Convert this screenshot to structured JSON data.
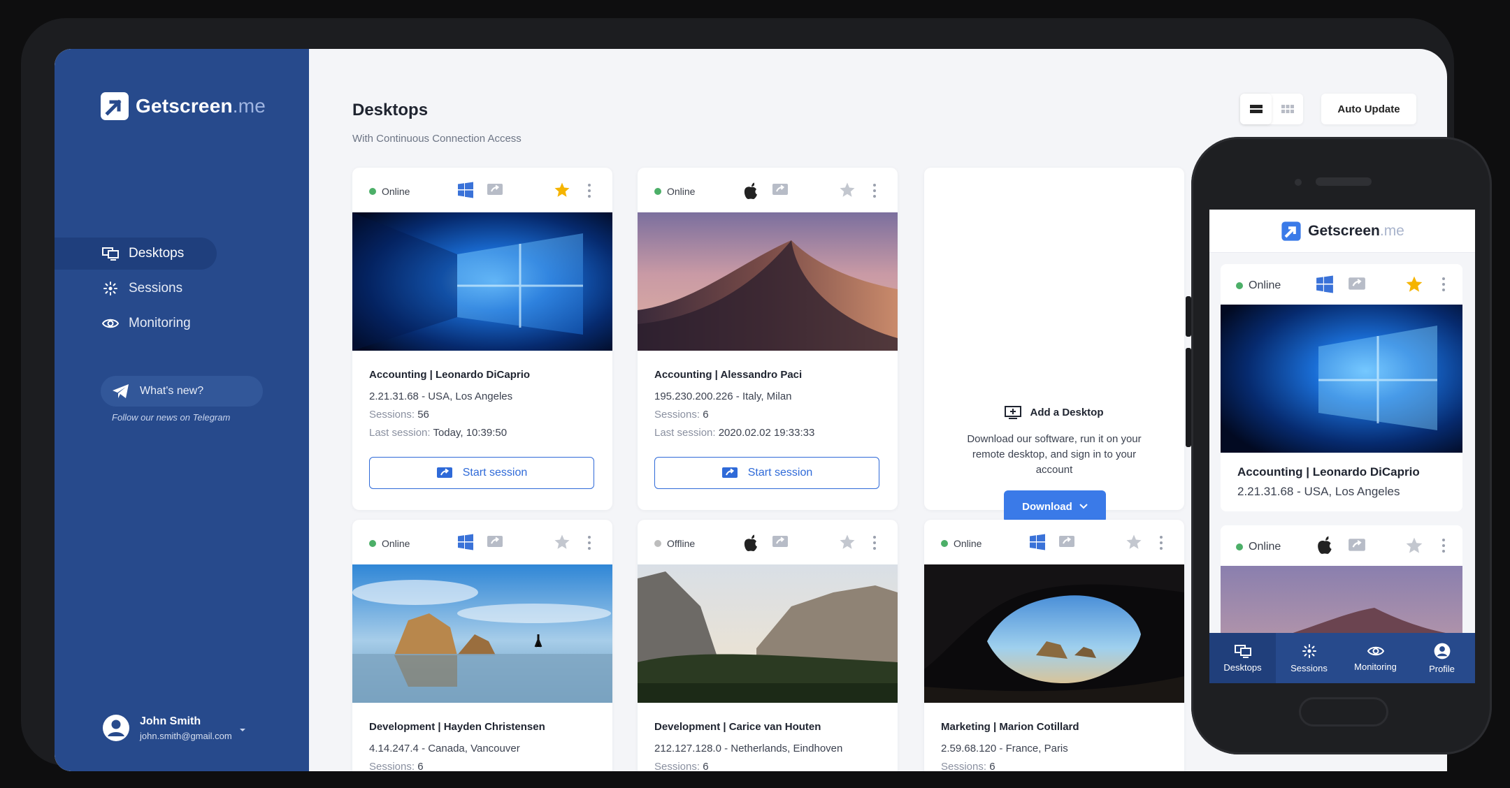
{
  "brand": {
    "name": "Getscreen",
    "suffix": ".me"
  },
  "sidebar": {
    "nav": [
      {
        "label": "Desktops",
        "icon": "desktops-icon",
        "active": true
      },
      {
        "label": "Sessions",
        "icon": "sessions-icon",
        "active": false
      },
      {
        "label": "Monitoring",
        "icon": "monitoring-icon",
        "active": false
      }
    ],
    "whats_new": "What's new?",
    "follow": "Follow our news on Telegram",
    "user": {
      "name": "John Smith",
      "email": "john.smith@gmail.com"
    }
  },
  "header": {
    "title": "Desktops",
    "subtitle": "With Continuous Connection Access",
    "auto_update": "Auto Update"
  },
  "cards": [
    {
      "status": "Online",
      "os": "windows",
      "starred": true,
      "title": "Accounting | Leonardo DiCaprio",
      "address": "2.21.31.68 - USA, Los Angeles",
      "sessions_label": "Sessions:",
      "sessions": "56",
      "last_label": "Last session:",
      "last": "Today, 10:39:50",
      "start": "Start session"
    },
    {
      "status": "Online",
      "os": "apple",
      "starred": false,
      "title": "Accounting | Alessandro Paci",
      "address": "195.230.200.226 - Italy, Milan",
      "sessions_label": "Sessions:",
      "sessions": "6",
      "last_label": "Last session:",
      "last": "2020.02.02 19:33:33",
      "start": "Start session"
    },
    {
      "status": "Online",
      "os": "windows",
      "starred": false,
      "title": "Development | Hayden Christensen",
      "address": "4.14.247.4 - Canada, Vancouver",
      "sessions_label": "Sessions:",
      "sessions": "6"
    },
    {
      "status": "Offline",
      "os": "apple",
      "starred": false,
      "title": "Development | Carice van Houten",
      "address": "212.127.128.0 - Netherlands, Eindhoven",
      "sessions_label": "Sessions:",
      "sessions": "6"
    },
    {
      "status": "Online",
      "os": "windows",
      "starred": false,
      "title": "Marketing | Marion Cotillard",
      "address": "2.59.68.120 - France, Paris",
      "sessions_label": "Sessions:",
      "sessions": "6"
    }
  ],
  "add_desktop": {
    "title": "Add a Desktop",
    "text": "Download our software, run it on your remote desktop, and sign in to your account",
    "button": "Download"
  },
  "mobile": {
    "cards": [
      {
        "status": "Online",
        "title": "Accounting | Leonardo DiCaprio",
        "address": "2.21.31.68 - USA, Los Angeles"
      },
      {
        "status": "Online"
      }
    ],
    "tabs": [
      "Desktops",
      "Sessions",
      "Monitoring",
      "Profile"
    ]
  },
  "colors": {
    "sidebar": "#274a8c",
    "accent": "#3a7ae8",
    "online": "#4caf68",
    "offline": "#bdbdbd",
    "star": "#f5b400"
  }
}
